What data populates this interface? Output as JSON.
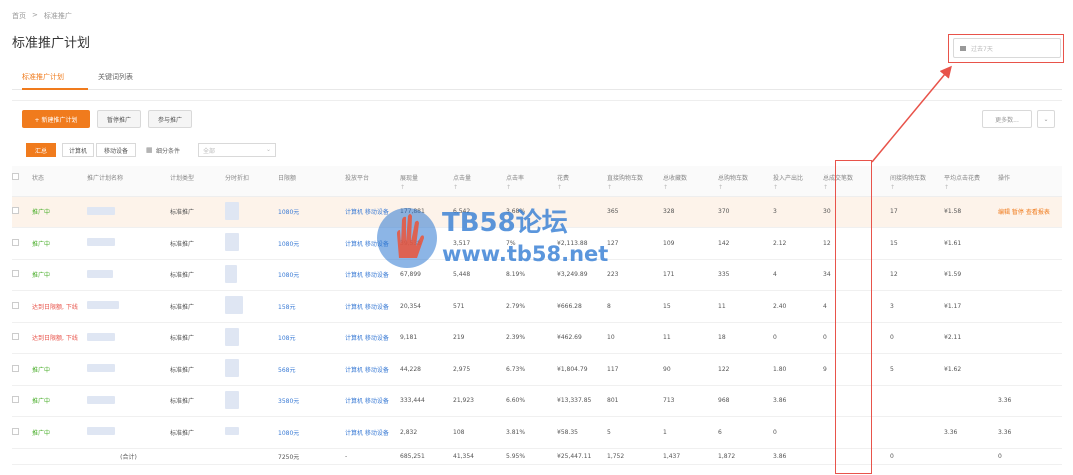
{
  "breadcrumb": [
    "首页",
    ">",
    "标准推广"
  ],
  "page_title": "标准推广计划",
  "tabs": [
    {
      "label": "标准推广计划",
      "active": true
    },
    {
      "label": "关键词列表",
      "active": false
    }
  ],
  "date_picker": {
    "label": "过去7天"
  },
  "toolbar": {
    "new_plan": "+ 新建推广计划",
    "pause": "暂停推广",
    "start": "参与推广",
    "more": "更多数..."
  },
  "filter": {
    "segments": [
      "汇总",
      "计算机",
      "移动设备"
    ],
    "report_label": "细分条件",
    "select_value": "全部"
  },
  "columns": [
    "状态",
    "推广计划名称",
    "计划类型",
    "分时折扣",
    "日限额",
    "投放平台",
    "展现量",
    "点击量",
    "点击率",
    "花费",
    "直接购物车数",
    "总收藏数",
    "总购物车数",
    "投入产出比",
    "总成交笔数",
    "间接购物车数",
    "平均点击花费",
    "操作"
  ],
  "rows": [
    {
      "status": "推广中",
      "status_type": "ok",
      "type": "标准推广",
      "budget": "1080元",
      "platform": "计算机 移动设备",
      "impressions": "177,881",
      "clicks": "6,542",
      "ctr": "3.68%",
      "cost": "",
      "direct_cart": "365",
      "fav": "328",
      "cart": "370",
      "roi": "3",
      "orders": "30",
      "indirect_cart": "17",
      "cpc": "¥1.58",
      "op": "编辑  暂停  查看报表"
    },
    {
      "status": "推广中",
      "status_type": "ok",
      "type": "标准推广",
      "budget": "1080元",
      "platform": "计算机 移动设备",
      "impressions": "39,538",
      "clicks": "3,517",
      "ctr": "7%",
      "cost": "¥2,113.88",
      "direct_cart": "127",
      "fav": "109",
      "cart": "142",
      "roi": "2.12",
      "orders": "12",
      "indirect_cart": "15",
      "cpc": "¥1.61",
      "op": ""
    },
    {
      "status": "推广中",
      "status_type": "ok",
      "type": "标准推广",
      "budget": "1080元",
      "platform": "计算机 移动设备",
      "impressions": "67,899",
      "clicks": "5,448",
      "ctr": "8.19%",
      "cost": "¥3,249.89",
      "direct_cart": "223",
      "fav": "171",
      "cart": "335",
      "roi": "4",
      "orders": "34",
      "indirect_cart": "12",
      "cpc": "¥1.59",
      "op": ""
    },
    {
      "status": "达到日限额, 下线",
      "status_type": "warn",
      "type": "标准推广",
      "budget": "158元",
      "platform": "计算机 移动设备",
      "impressions": "20,354",
      "clicks": "571",
      "ctr": "2.79%",
      "cost": "¥666.28",
      "direct_cart": "8",
      "fav": "15",
      "cart": "11",
      "roi": "2.40",
      "orders": "4",
      "indirect_cart": "3",
      "cpc": "¥1.17",
      "op": ""
    },
    {
      "status": "达到日限额, 下线",
      "status_type": "warn",
      "type": "标准推广",
      "budget": "108元",
      "platform": "计算机 移动设备",
      "impressions": "9,181",
      "clicks": "219",
      "ctr": "2.39%",
      "cost": "¥462.69",
      "direct_cart": "10",
      "fav": "11",
      "cart": "18",
      "roi": "0",
      "orders": "0",
      "indirect_cart": "0",
      "cpc": "¥2.11",
      "op": ""
    },
    {
      "status": "推广中",
      "status_type": "ok",
      "type": "标准推广",
      "budget": "568元",
      "platform": "计算机 移动设备",
      "impressions": "44,228",
      "clicks": "2,975",
      "ctr": "6.73%",
      "cost": "¥1,804.79",
      "direct_cart": "117",
      "fav": "90",
      "cart": "122",
      "roi": "1.80",
      "orders": "9",
      "indirect_cart": "5",
      "cpc": "¥1.62",
      "op": ""
    },
    {
      "status": "推广中",
      "status_type": "ok",
      "type": "标准推广",
      "budget": "3580元",
      "platform": "计算机 移动设备",
      "impressions": "333,444",
      "clicks": "21,923",
      "ctr": "6.60%",
      "cost": "¥13,337.85",
      "direct_cart": "801",
      "fav": "713",
      "cart": "968",
      "roi": "3.86",
      "orders": "",
      "indirect_cart": "",
      "cpc": "",
      "op": "3.36"
    },
    {
      "status": "推广中",
      "status_type": "ok",
      "type": "标准推广",
      "budget": "1080元",
      "platform": "计算机 移动设备",
      "impressions": "2,832",
      "clicks": "108",
      "ctr": "3.81%",
      "cost": "¥58.35",
      "direct_cart": "5",
      "fav": "1",
      "cart": "6",
      "roi": "0",
      "orders": "",
      "indirect_cart": "",
      "cpc": "3.36",
      "op": "3.36"
    }
  ],
  "total": {
    "label": "(合计)",
    "budget": "7250元",
    "platform": "-",
    "impressions": "685,251",
    "clicks": "41,354",
    "ctr": "5.95%",
    "cost": "¥25,447.11",
    "direct_cart": "1,752",
    "fav": "1,437",
    "cart": "1,872",
    "roi": "3.86",
    "indirect_cart": "0",
    "op": "0"
  },
  "watermark": {
    "line1": "TB58论坛",
    "line2": "www.tb58.net"
  },
  "colors": {
    "accent": "#f07b1d",
    "link": "#3a7bd5",
    "ok": "#4caf2d",
    "warn": "#e8534a",
    "annotation": "#e8534a",
    "watermark": "#2d78d2"
  }
}
